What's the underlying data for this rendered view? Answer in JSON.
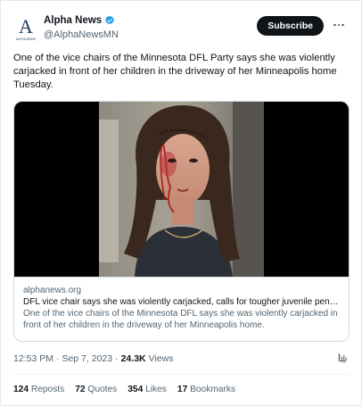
{
  "account": {
    "display_name": "Alpha News",
    "handle": "@AlphaNewsMN",
    "verified": true,
    "avatar_logo": "A",
    "avatar_caption": "ALPHA NEWS"
  },
  "actions": {
    "subscribe_label": "Subscribe",
    "more_icon": "more-horizontal-icon"
  },
  "tweet": {
    "text": "One of the vice chairs of the Minnesota DFL Party says she was violently carjacked in front of her children in the driveway of her Minneapolis home Tuesday."
  },
  "link_card": {
    "domain": "alphanews.org",
    "title": "DFL vice chair says she was violently carjacked, calls for tougher juvenile pen…",
    "description": "One of the vice chairs of the Minnesota DFL says she was violently carjacked in front of her children in the driveway of her Minneapolis home."
  },
  "meta": {
    "time": "12:53 PM",
    "separator": "·",
    "date": "Sep 7, 2023",
    "views_count": "24.3K",
    "views_label": "Views"
  },
  "stats": {
    "reposts_count": "124",
    "reposts_label": "Reposts",
    "quotes_count": "72",
    "quotes_label": "Quotes",
    "likes_count": "354",
    "likes_label": "Likes",
    "bookmarks_count": "17",
    "bookmarks_label": "Bookmarks"
  },
  "colors": {
    "brand_blue": "#1d9bf0",
    "text_primary": "#0f1419",
    "text_secondary": "#536471",
    "border": "#cfd9de"
  }
}
